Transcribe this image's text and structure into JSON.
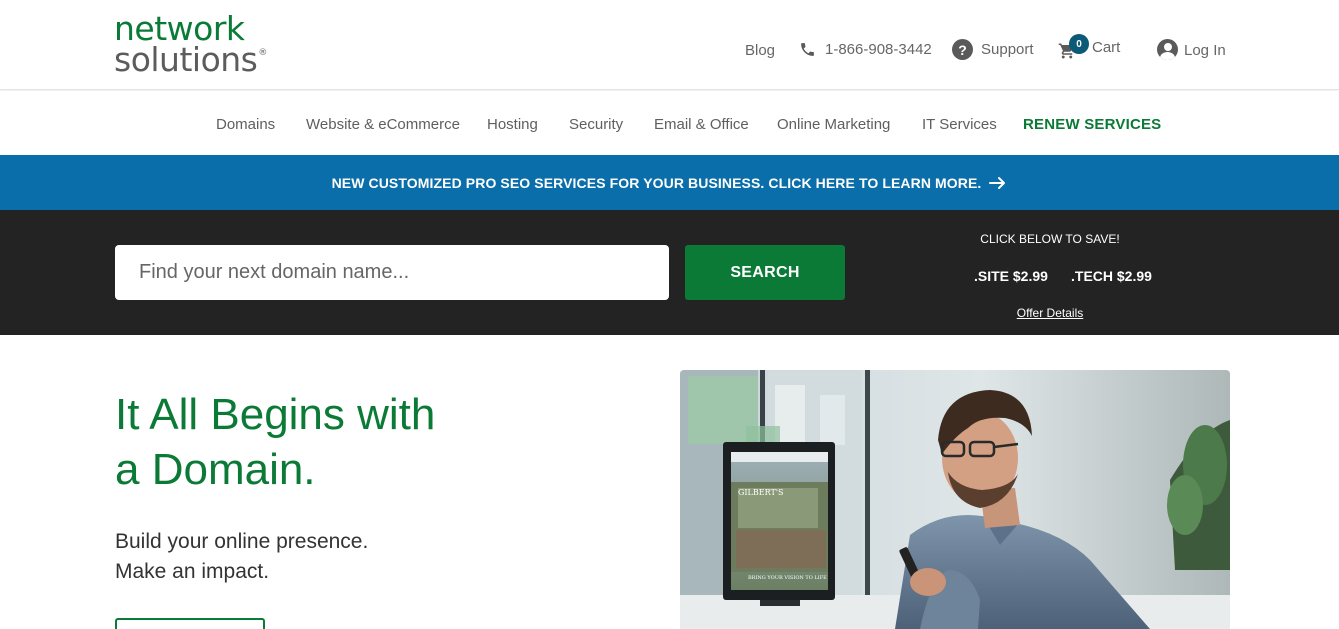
{
  "brand": {
    "line1": "network",
    "line2": "solutions",
    "reg": "®"
  },
  "util_nav": {
    "blog": "Blog",
    "phone": "1-866-908-3442",
    "support": "Support",
    "support_glyph": "?",
    "cart": "Cart",
    "cart_count": "0",
    "login": "Log In"
  },
  "main_nav": {
    "items": [
      "Domains",
      "Website & eCommerce",
      "Hosting",
      "Security",
      "Email & Office",
      "Online Marketing",
      "IT Services"
    ],
    "renew": "RENEW SERVICES"
  },
  "promo_banner": {
    "text": "NEW CUSTOMIZED PRO SEO SERVICES FOR YOUR BUSINESS. CLICK HERE TO LEARN MORE."
  },
  "search": {
    "placeholder": "Find your next domain name...",
    "value": "",
    "button": "SEARCH"
  },
  "offer": {
    "header": "CLICK BELOW TO SAVE!",
    "tld1": ".SITE $2.99",
    "tld2": ".TECH $2.99",
    "details": "Offer Details"
  },
  "hero": {
    "title_line1": "It All Begins with",
    "title_line2": "a Domain.",
    "sub_line1": "Build your online presence.",
    "sub_line2": "Make an impact.",
    "screen_brand": "GILBERT'S",
    "screen_tagline": "BRING YOUR VISION TO LIFE"
  },
  "colors": {
    "brand_green": "#0b7a37",
    "banner_blue": "#0a6eaa",
    "search_band": "#232323",
    "cart_badge": "#0a5a78"
  },
  "icons": {
    "phone": "phone-icon",
    "support": "question-circle-icon",
    "cart": "cart-icon",
    "login": "user-circle-icon",
    "banner_arrow": "arrow-right-icon"
  }
}
